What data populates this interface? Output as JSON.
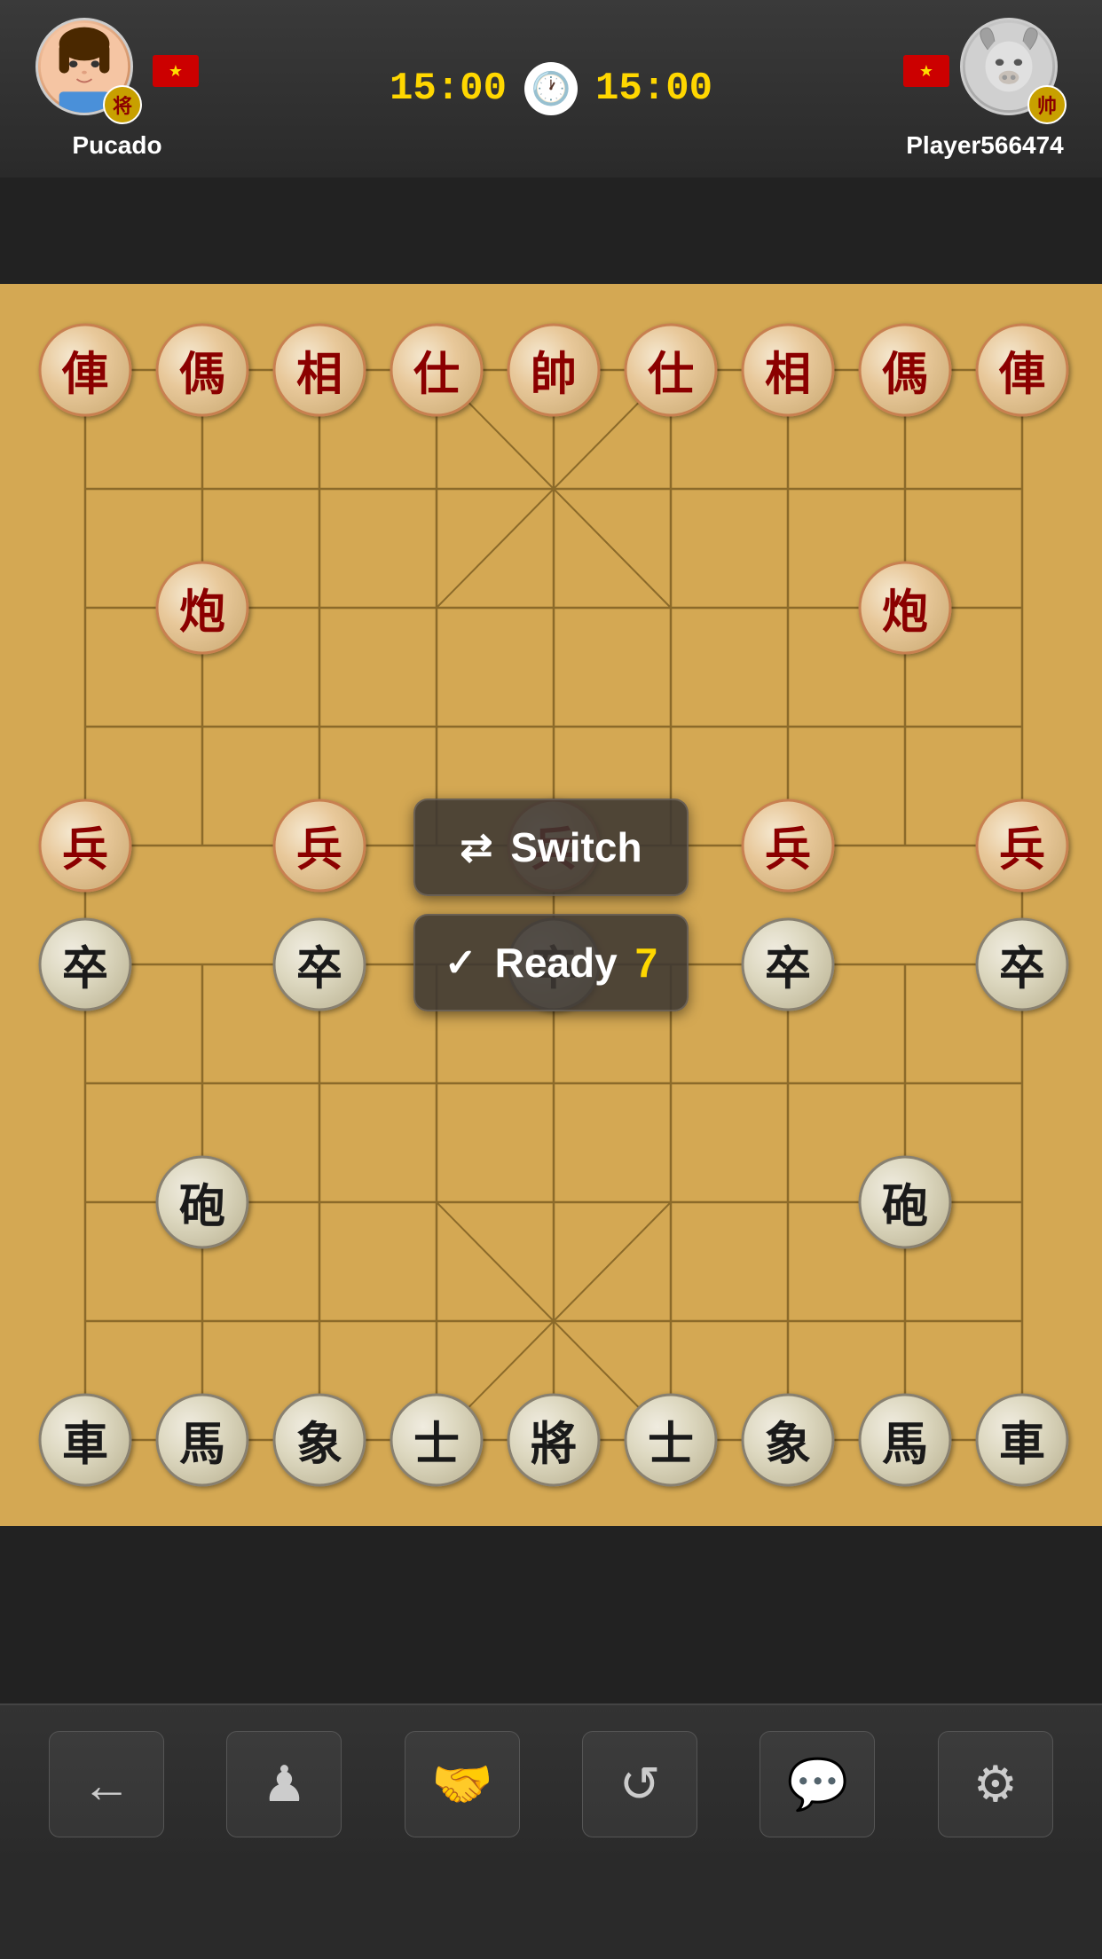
{
  "header": {
    "player1": {
      "name": "Pucado",
      "badge": "将",
      "avatar_type": "female"
    },
    "player2": {
      "name": "Player566474",
      "badge": "帅",
      "avatar_type": "male"
    },
    "timer1": "15:00",
    "timer2": "15:00"
  },
  "board": {
    "cols": 9,
    "rows": 10
  },
  "buttons": {
    "switch_label": "Switch",
    "ready_label": "Ready",
    "ready_count": "7"
  },
  "footer": {
    "back": "←",
    "player_icon": "♟",
    "handshake": "🤝",
    "undo": "↺",
    "chat": "💬",
    "settings": "⚙"
  },
  "pieces_red": [
    {
      "char": "俥",
      "col": 0,
      "row": 0
    },
    {
      "char": "傌",
      "col": 1,
      "row": 0
    },
    {
      "char": "相",
      "col": 2,
      "row": 0
    },
    {
      "char": "仕",
      "col": 3,
      "row": 0
    },
    {
      "char": "帥",
      "col": 4,
      "row": 0
    },
    {
      "char": "仕",
      "col": 5,
      "row": 0
    },
    {
      "char": "相",
      "col": 6,
      "row": 0
    },
    {
      "char": "傌",
      "col": 7,
      "row": 0
    },
    {
      "char": "俥",
      "col": 8,
      "row": 0
    },
    {
      "char": "炮",
      "col": 1,
      "row": 2
    },
    {
      "char": "炮",
      "col": 7,
      "row": 2
    },
    {
      "char": "兵",
      "col": 0,
      "row": 4
    },
    {
      "char": "兵",
      "col": 2,
      "row": 4
    },
    {
      "char": "兵",
      "col": 4,
      "row": 4
    },
    {
      "char": "兵",
      "col": 6,
      "row": 4
    },
    {
      "char": "兵",
      "col": 8,
      "row": 4
    }
  ],
  "pieces_black": [
    {
      "char": "卒",
      "col": 0,
      "row": 5
    },
    {
      "char": "卒",
      "col": 2,
      "row": 5
    },
    {
      "char": "卒",
      "col": 4,
      "row": 5
    },
    {
      "char": "卒",
      "col": 6,
      "row": 5
    },
    {
      "char": "卒",
      "col": 8,
      "row": 5
    },
    {
      "char": "砲",
      "col": 1,
      "row": 7
    },
    {
      "char": "砲",
      "col": 7,
      "row": 7
    },
    {
      "char": "車",
      "col": 0,
      "row": 9
    },
    {
      "char": "馬",
      "col": 1,
      "row": 9
    },
    {
      "char": "象",
      "col": 2,
      "row": 9
    },
    {
      "char": "士",
      "col": 3,
      "row": 9
    },
    {
      "char": "將",
      "col": 4,
      "row": 9
    },
    {
      "char": "士",
      "col": 5,
      "row": 9
    },
    {
      "char": "象",
      "col": 6,
      "row": 9
    },
    {
      "char": "馬",
      "col": 7,
      "row": 9
    },
    {
      "char": "車",
      "col": 8,
      "row": 9
    }
  ]
}
